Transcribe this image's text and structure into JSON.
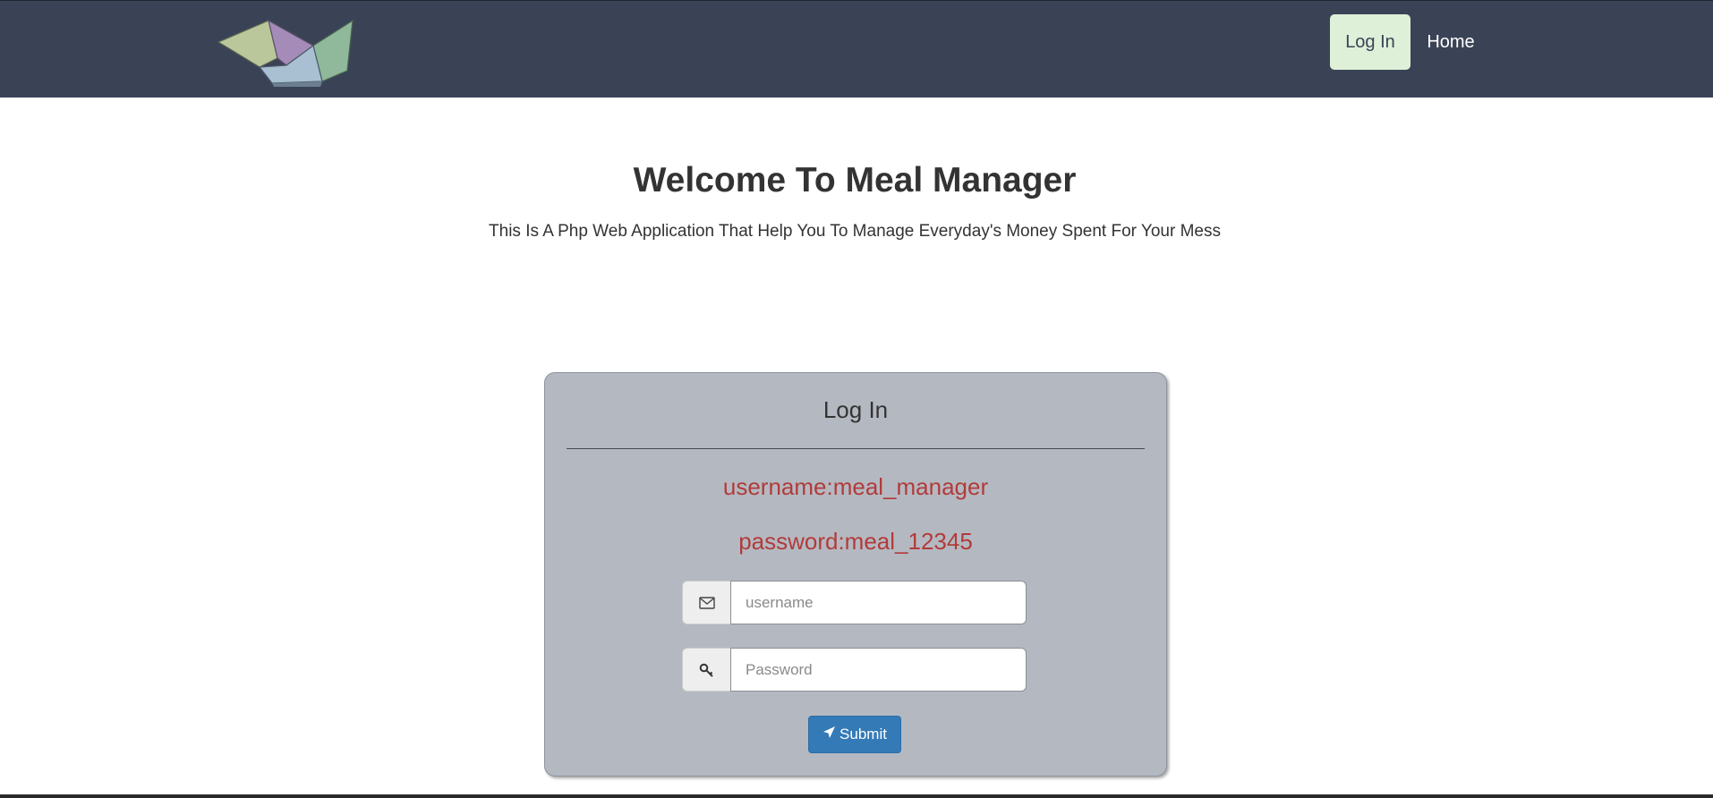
{
  "navbar": {
    "logo_icon": "folded-paper-boat-logo",
    "login_label": "Log In",
    "home_label": "Home",
    "background": "#3a4356",
    "active_background": "#dff0d8"
  },
  "hero": {
    "title": "Welcome To Meal Manager",
    "subtitle": "This Is A Php Web Application That Help You To Manage Everyday's Money Spent For Your Mess"
  },
  "login_panel": {
    "title": "Log In",
    "username_hint": "username:meal_manager",
    "password_hint": "password:meal_12345",
    "hint_color": "#b23b3b",
    "username_field": {
      "icon": "envelope-icon",
      "value": "",
      "placeholder": "username"
    },
    "password_field": {
      "icon": "key-icon",
      "value": "",
      "placeholder": "Password"
    },
    "submit_icon": "paper-plane-icon",
    "submit_label": "Submit",
    "submit_color": "#337ab7"
  }
}
